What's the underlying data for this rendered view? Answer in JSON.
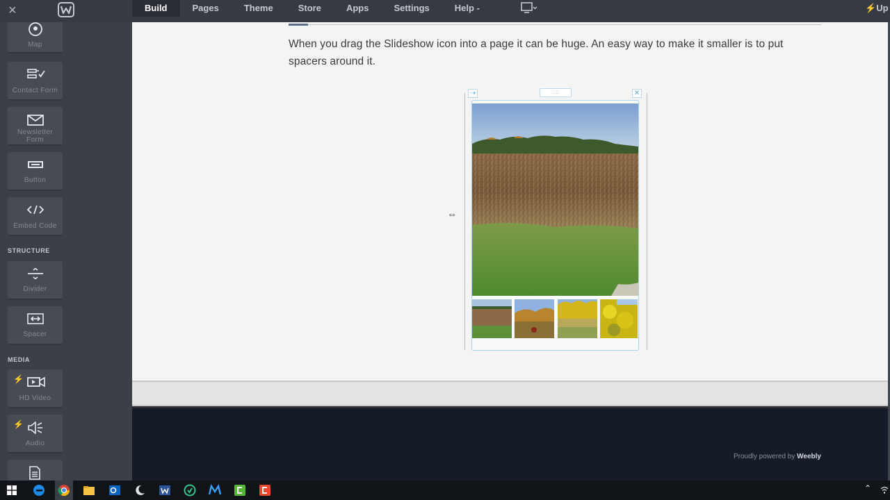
{
  "app": {
    "close_glyph": "×",
    "logo": "w-logo-icon"
  },
  "nav": {
    "items": [
      {
        "label": "Build",
        "active": true
      },
      {
        "label": "Pages",
        "active": false
      },
      {
        "label": "Theme",
        "active": false
      },
      {
        "label": "Store",
        "active": false
      },
      {
        "label": "Apps",
        "active": false
      },
      {
        "label": "Settings",
        "active": false
      },
      {
        "label": "Help -",
        "active": false
      }
    ],
    "device_toggle": "desktop-icon",
    "upgrade_label": "Up"
  },
  "sidebar": {
    "tiles": [
      {
        "label": "Map",
        "icon": "map-pin-icon"
      },
      {
        "label": "Contact Form",
        "icon": "contact-form-icon"
      },
      {
        "label": "Newsletter Form",
        "icon": "envelope-icon"
      },
      {
        "label": "Button",
        "icon": "button-icon"
      },
      {
        "label": "Embed Code",
        "icon": "code-icon"
      }
    ],
    "structure_heading": "STRUCTURE",
    "structure_tiles": [
      {
        "label": "Divider",
        "icon": "divider-icon"
      },
      {
        "label": "Spacer",
        "icon": "spacer-icon"
      }
    ],
    "media_heading": "MEDIA",
    "media_tiles": [
      {
        "label": "HD Video",
        "icon": "video-icon",
        "premium": true
      },
      {
        "label": "Audio",
        "icon": "speaker-icon",
        "premium": true
      },
      {
        "label": "",
        "icon": "document-icon",
        "premium": false
      }
    ],
    "bolt_glyph": "⚡"
  },
  "canvas": {
    "paragraph": "When you drag the Slideshow icon into a page it can be huge. An easy way to make it smaller is to put spacers around it.",
    "slideshow": {
      "main_image": "cornfield-photo",
      "thumbnails": [
        "field-thumb-1",
        "trees-thumb-2",
        "yellow-field-thumb-3",
        "yellow-flowers-thumb-4"
      ],
      "move_glyph": "⇢",
      "delete_glyph": "✕",
      "handle_glyph": "::::"
    },
    "resize_cursor": "⇔"
  },
  "footer": {
    "powered_prefix": "Proudly powered by ",
    "powered_brand": "Weebly"
  },
  "taskbar": {
    "apps": [
      "windows-start-icon",
      "edge-icon",
      "chrome-icon",
      "file-explorer-icon",
      "outlook-icon",
      "app-moon-icon",
      "word-icon",
      "app-green-circle-icon",
      "app-m-icon",
      "camtasia-green-icon",
      "camtasia-red-icon"
    ],
    "tray_glyph": "⌃"
  },
  "colors": {
    "topbar": "#363a42",
    "sidebar": "#3b3f46",
    "canvas": "#f4f4f4",
    "footer": "#161b28",
    "accent_selection": "#4fa9d6",
    "premium_bolt": "#f5a623"
  }
}
